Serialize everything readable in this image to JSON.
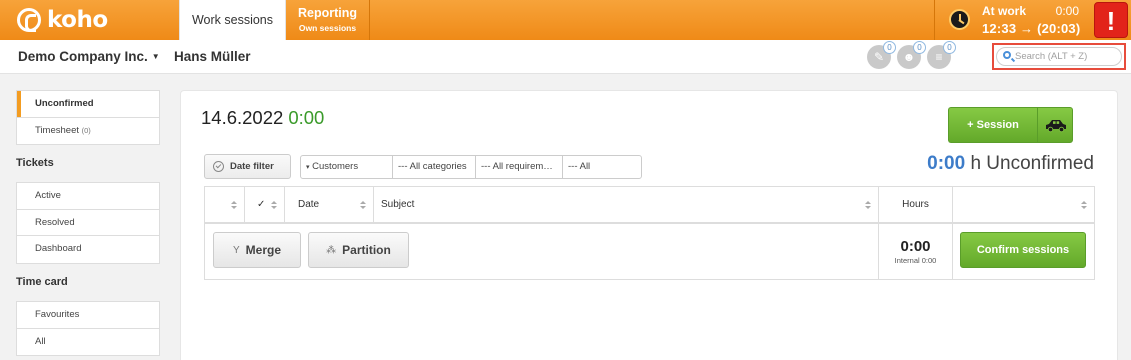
{
  "brand": {
    "name": "koho"
  },
  "tabs": [
    {
      "label": "Work sessions"
    },
    {
      "label": "Reporting",
      "sublabel": "Own sessions"
    }
  ],
  "status": {
    "label": "At work",
    "duration": "0:00",
    "time": "12:33 → (20:03)",
    "alert": "!"
  },
  "subbar": {
    "company": "Demo Company Inc.",
    "user": "Hans Müller",
    "notifications": [
      {
        "icon": "tag-icon",
        "count": "0"
      },
      {
        "icon": "users-icon",
        "count": "0"
      },
      {
        "icon": "list-icon",
        "count": "0"
      }
    ],
    "search_placeholder": "Search (ALT + Z)"
  },
  "sidebar": {
    "group1": [
      {
        "label": "Unconfirmed"
      },
      {
        "label": "Timesheet",
        "count": "(0)"
      }
    ],
    "tickets_heading": "Tickets",
    "tickets": [
      {
        "label": "Active"
      },
      {
        "label": "Resolved"
      },
      {
        "label": "Dashboard"
      }
    ],
    "timecard_heading": "Time card",
    "timecard": [
      {
        "label": "Favourites"
      },
      {
        "label": "All"
      }
    ]
  },
  "main": {
    "date": "14.6.2022",
    "date_time": "0:00",
    "session_button": "+ Session",
    "date_filter": "Date filter",
    "filters": [
      "Customers",
      "--- All categories",
      "--- All requirem…",
      "--- All"
    ],
    "unconfirmed_num": "0:00",
    "unconfirmed_text": "h Unconfirmed",
    "columns": {
      "check": "✓",
      "date": "Date",
      "subject": "Subject",
      "hours": "Hours"
    },
    "merge": "Merge",
    "partition": "Partition",
    "hours_total": "0:00",
    "hours_internal": "Internal 0:00",
    "confirm": "Confirm sessions"
  }
}
